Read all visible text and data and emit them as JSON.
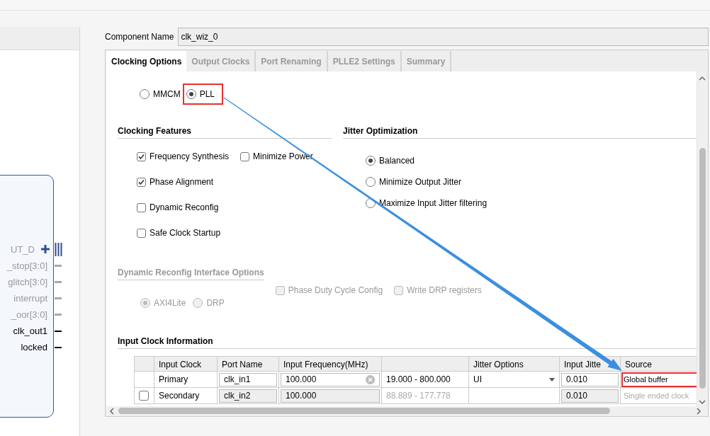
{
  "symbol": {
    "pins": [
      {
        "label": "UT_D",
        "kind": "bus",
        "disabled": true
      },
      {
        "label": "_stop[3:0]",
        "kind": "wire",
        "disabled": true
      },
      {
        "label": "glitch[3:0]",
        "kind": "wire",
        "disabled": true
      },
      {
        "label": "interrupt",
        "kind": "wire",
        "disabled": true
      },
      {
        "label": "_oor[3:0]",
        "kind": "wire",
        "disabled": true
      },
      {
        "label": "clk_out1",
        "kind": "wire",
        "disabled": false
      },
      {
        "label": "locked",
        "kind": "wire",
        "disabled": false
      }
    ]
  },
  "component_name": {
    "label": "Component Name",
    "value": "clk_wiz_0"
  },
  "tabs": [
    {
      "label": "Clocking Options",
      "selected": true
    },
    {
      "label": "Output Clocks",
      "selected": false
    },
    {
      "label": "Port Renaming",
      "selected": false
    },
    {
      "label": "PLLE2 Settings",
      "selected": false
    },
    {
      "label": "Summary",
      "selected": false
    }
  ],
  "primitive": [
    {
      "label": "MMCM",
      "selected": false,
      "highlighted": false
    },
    {
      "label": "PLL",
      "selected": true,
      "highlighted": true
    }
  ],
  "clocking_features": {
    "title": "Clocking Features",
    "options": [
      {
        "label": "Frequency Synthesis",
        "checked": true
      },
      {
        "label": "Minimize Power",
        "checked": false
      },
      {
        "label": "Phase Alignment",
        "checked": true
      },
      {
        "label": "Dynamic Reconfig",
        "checked": false
      },
      {
        "label": "Safe Clock Startup",
        "checked": false
      }
    ]
  },
  "jitter_optimization": {
    "title": "Jitter Optimization",
    "options": [
      {
        "label": "Balanced",
        "selected": true
      },
      {
        "label": "Minimize Output Jitter",
        "selected": false
      },
      {
        "label": "Maximize Input Jitter filtering",
        "selected": false
      }
    ]
  },
  "dynamic_reconfig": {
    "title": "Dynamic Reconfig Interface Options",
    "disabled": true,
    "interfaces": [
      {
        "label": "AXI4Lite",
        "selected": true
      },
      {
        "label": "DRP",
        "selected": false
      }
    ],
    "options": [
      {
        "label": "Phase Duty Cycle Config",
        "checked": false
      },
      {
        "label": "Write DRP registers",
        "checked": false
      }
    ]
  },
  "input_clock": {
    "title": "Input Clock Information",
    "columns": [
      {
        "kind": "blank"
      },
      {
        "kind": "label",
        "label": "Input Clock"
      },
      {
        "kind": "label",
        "label": "Port Name"
      },
      {
        "kind": "label",
        "label": "Input Frequency(MHz)"
      },
      {
        "kind": "blank"
      },
      {
        "kind": "label",
        "label": "Jitter Options"
      },
      {
        "kind": "label",
        "label": "Input Jitte"
      },
      {
        "kind": "label",
        "label": "Source"
      }
    ],
    "rows": [
      {
        "cells": [
          {
            "kind": "blank"
          },
          {
            "kind": "text",
            "text": "Primary"
          },
          {
            "kind": "input",
            "value": "clk_in1",
            "disabled": false
          },
          {
            "kind": "input",
            "value": "100.000",
            "disabled": false,
            "clearable": true
          },
          {
            "kind": "text",
            "text": "19.000 - 800.000"
          },
          {
            "kind": "dropdown",
            "value": "UI"
          },
          {
            "kind": "input",
            "value": "0.010",
            "disabled": false
          },
          {
            "kind": "text",
            "text": "Global buffer",
            "highlighted": true
          }
        ]
      },
      {
        "cells": [
          {
            "kind": "check",
            "checked": false
          },
          {
            "kind": "text",
            "text": "Secondary"
          },
          {
            "kind": "input",
            "value": "clk_in2",
            "disabled": true
          },
          {
            "kind": "input",
            "value": "100.000",
            "disabled": true
          },
          {
            "kind": "text",
            "text": "88.889 - 177.778",
            "disabled": true
          },
          {
            "kind": "blank"
          },
          {
            "kind": "input",
            "value": "0.010",
            "disabled": true
          },
          {
            "kind": "text",
            "text": "Single ended clock",
            "disabled": true
          }
        ]
      }
    ]
  }
}
